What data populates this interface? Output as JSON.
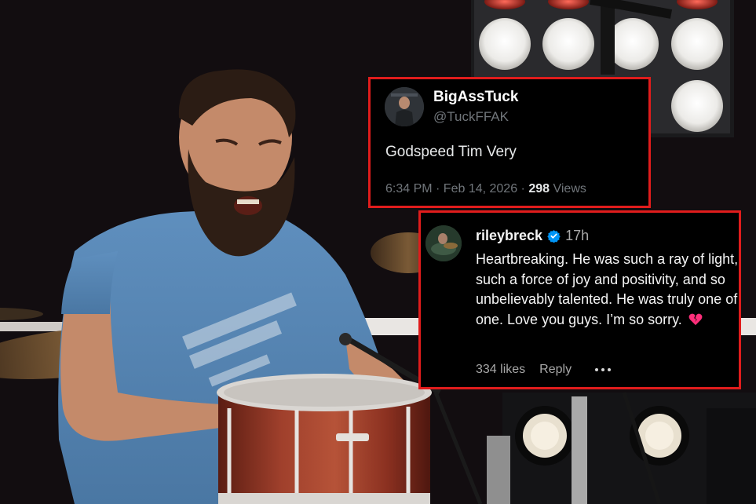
{
  "tweet": {
    "display_name": "BigAssTuck",
    "handle": "@TuckFFAK",
    "text": "Godspeed Tim Very",
    "timestamp": "6:34 PM · Feb 14, 2026 · ",
    "views_count": "298",
    "views_label": " Views"
  },
  "comment": {
    "username": "rileybreck",
    "time": "17h",
    "text": "Heartbreaking. He was such a ray of light, such a force of joy and positivity, and so unbelievably talented. He was truly one of one. Love you guys. I’m so sorry.",
    "likes": "334 likes",
    "reply_label": "Reply"
  },
  "colors": {
    "frame_red": "#e01c1c",
    "card_bg": "#000000",
    "verified_blue": "#0095f6",
    "broken_heart": "#ff2f7a"
  },
  "icons": {
    "verified": "verified-badge-icon",
    "broken_heart": "broken-heart-icon",
    "more": "more-options-icon"
  }
}
